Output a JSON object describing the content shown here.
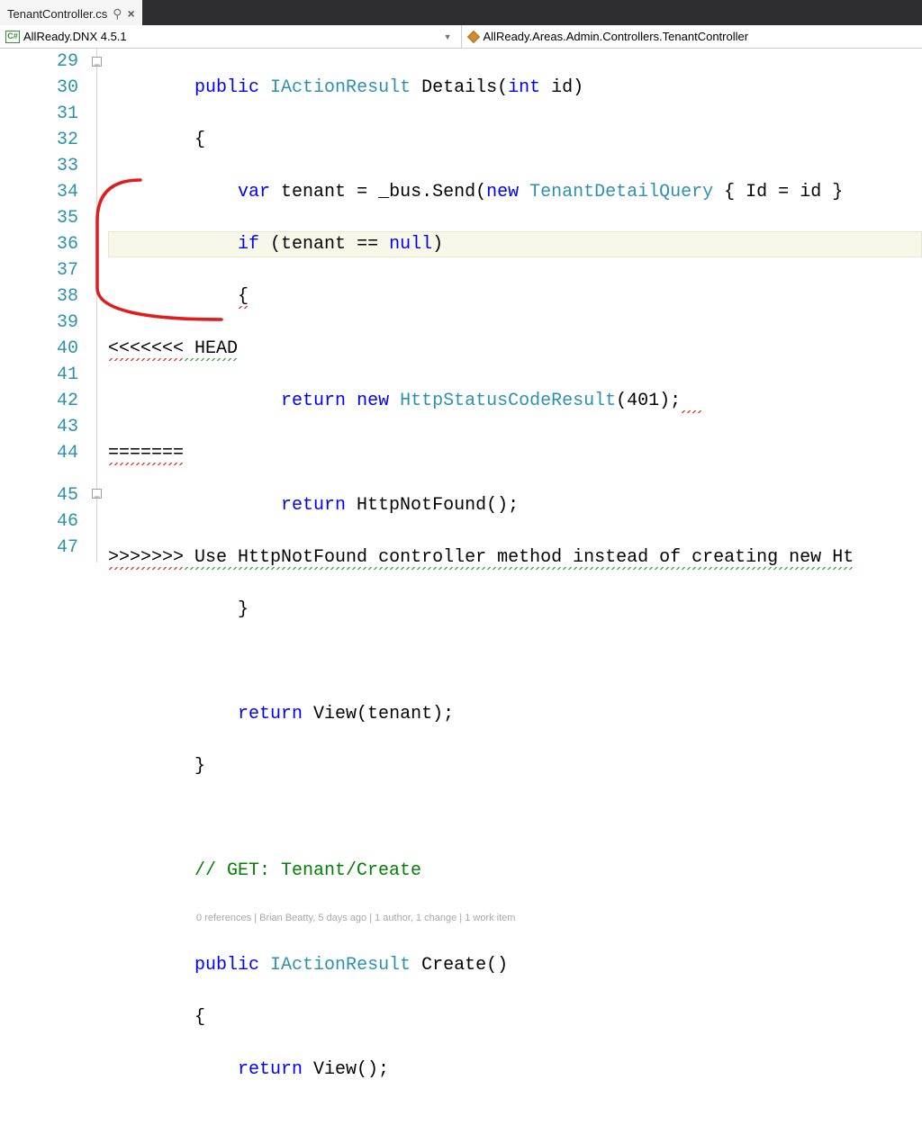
{
  "tab": {
    "filename": "TenantController.cs",
    "pin_icon": "pin",
    "close_icon": "close"
  },
  "nav": {
    "left": "AllReady.DNX 4.5.1",
    "right": "AllReady.Areas.Admin.Controllers.TenantController"
  },
  "line_numbers": [
    "29",
    "30",
    "31",
    "32",
    "33",
    "34",
    "35",
    "36",
    "37",
    "38",
    "39",
    "40",
    "41",
    "42",
    "43",
    "44",
    "45",
    "46",
    "47"
  ],
  "code": {
    "l29": {
      "a": "public",
      "b": "IActionResult",
      "c": "Details(",
      "d": "int",
      "e": " id)"
    },
    "l30": "{",
    "l31": {
      "a": "var",
      "b": " tenant = _bus.Send(",
      "c": "new",
      "d": " ",
      "e": "TenantDetailQuery",
      "f": " { Id = id }"
    },
    "l32": {
      "a": "if",
      "b": " (tenant == ",
      "c": "null",
      "d": ")"
    },
    "l33": "{",
    "l34": {
      "a": "<<<<<<<",
      "b": " HEAD"
    },
    "l35": {
      "a": "return",
      "b": " ",
      "c": "new",
      "d": " ",
      "e": "HttpStatusCodeResult",
      "f": "(401);"
    },
    "l36": "=======",
    "l37": {
      "a": "return",
      "b": " HttpNotFound();"
    },
    "l38": {
      "a": ">>>>>>>",
      "b": " Use",
      "c": " HttpNotFound",
      "d": " controller",
      "e": " method",
      "f": " instead",
      "g": " of",
      "h": " creating",
      "i": " new",
      "j": " Ht"
    },
    "l39": "}",
    "l41": {
      "a": "return",
      "b": " View(tenant);"
    },
    "l42": "}",
    "l44": "// GET: Tenant/Create",
    "codelens": "0 references | Brian Beatty, 5 days ago | 1 author, 1 change | 1 work item",
    "l45": {
      "a": "public",
      "b": " ",
      "c": "IActionResult",
      "d": " Create()"
    },
    "l46": "{",
    "l47": {
      "a": "return",
      "b": " View();"
    }
  }
}
